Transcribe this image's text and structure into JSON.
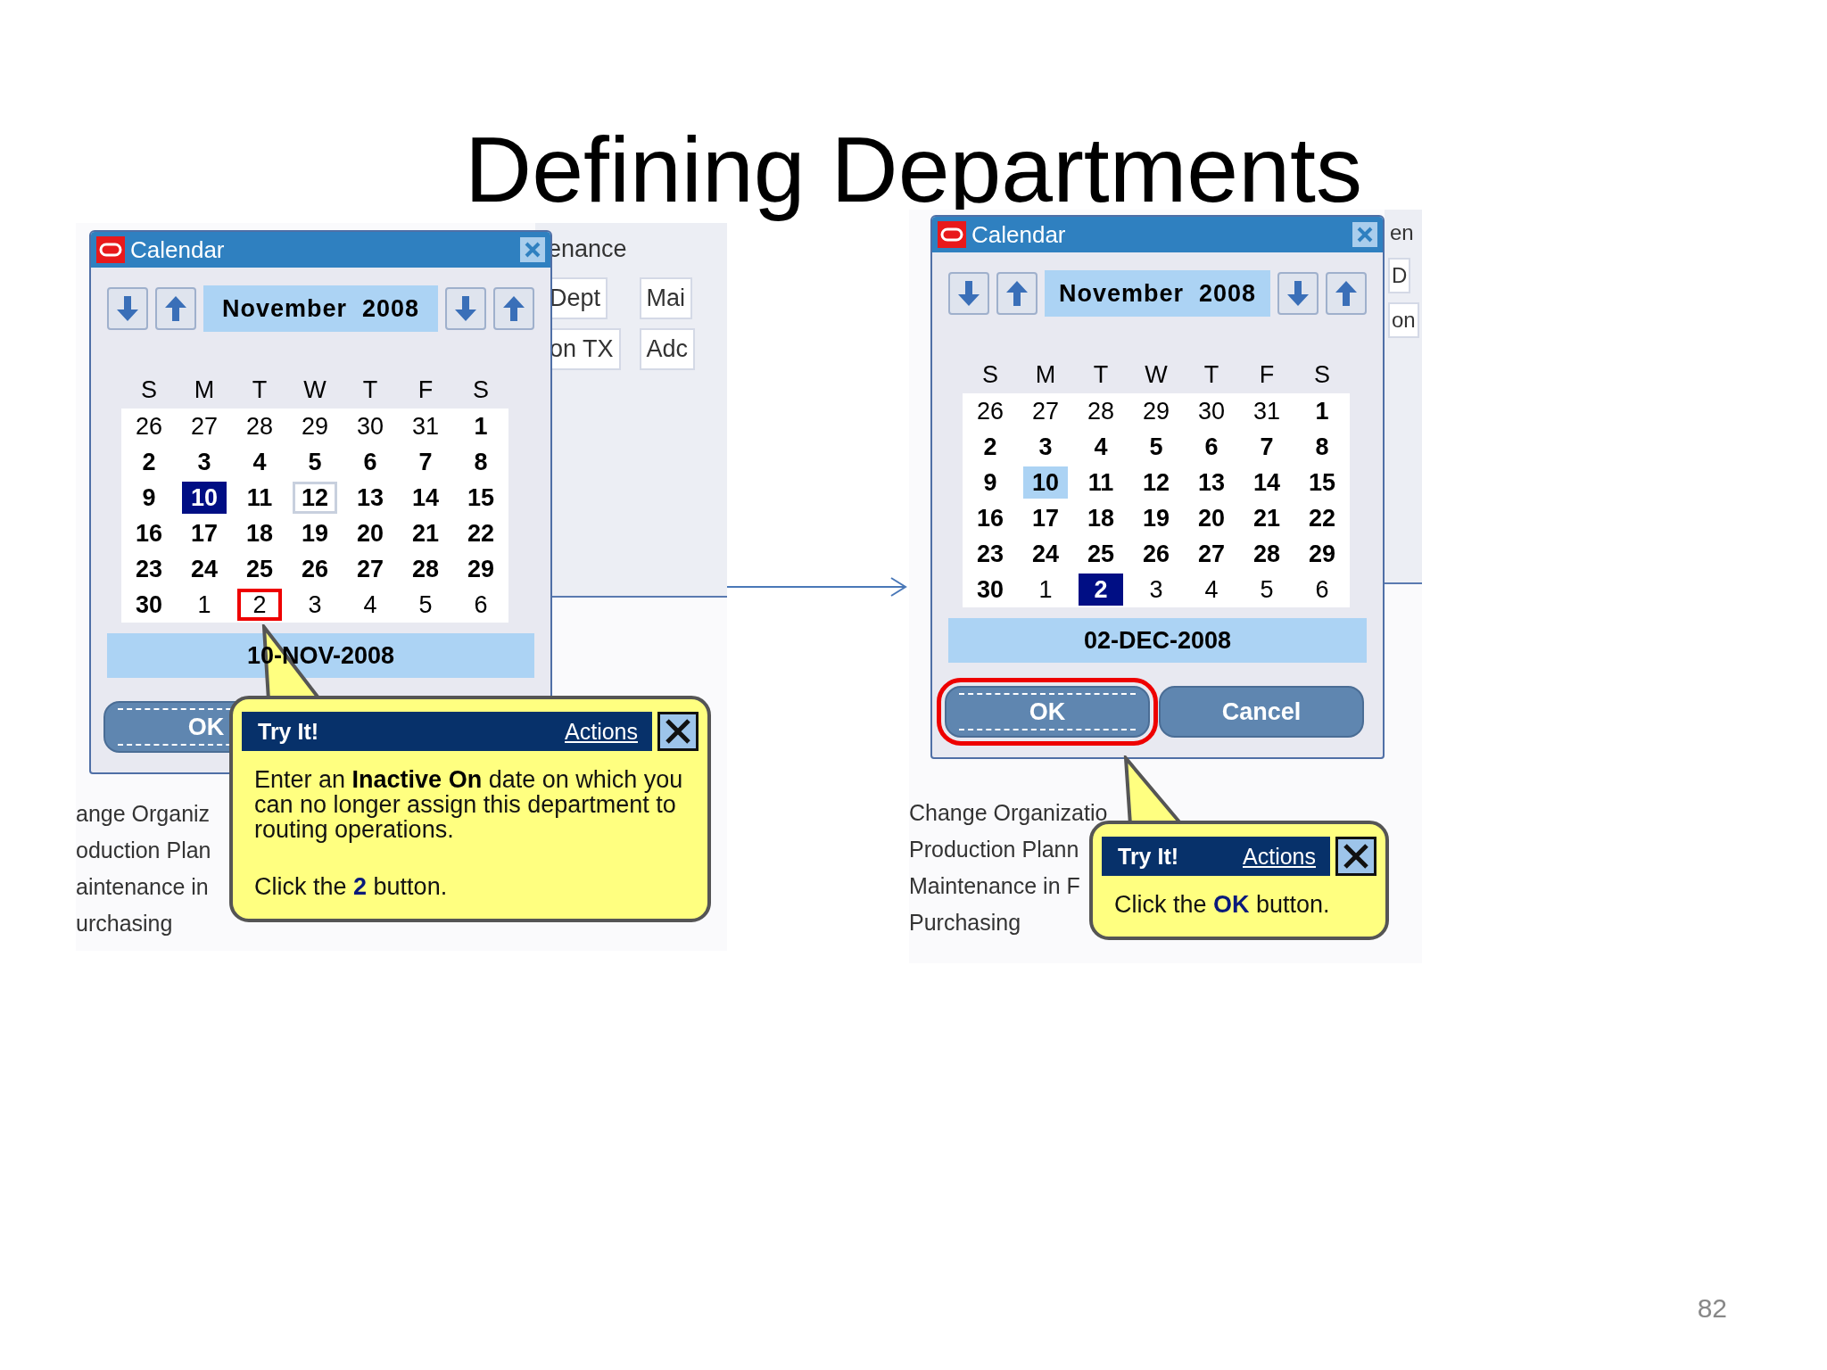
{
  "title": "Defining Departments",
  "panels": [
    {
      "backdrop": {
        "top_texts": [
          "enance",
          "Dept",
          "Mai",
          "on TX",
          "Adc"
        ],
        "list": [
          "ange Organiz",
          "oduction Plan",
          "aintenance in",
          "urchasing"
        ]
      },
      "calendar": {
        "title": "Calendar",
        "month": "November  2008",
        "weekdays": [
          "S",
          "M",
          "T",
          "W",
          "T",
          "F",
          "S"
        ],
        "weeks": [
          [
            {
              "label": "26",
              "outside": true,
              "selected": false,
              "outlined": false,
              "shaded": false,
              "target": false
            },
            {
              "label": "27",
              "outside": true,
              "selected": false,
              "outlined": false,
              "shaded": false,
              "target": false
            },
            {
              "label": "28",
              "outside": true,
              "selected": false,
              "outlined": false,
              "shaded": false,
              "target": false
            },
            {
              "label": "29",
              "outside": true,
              "selected": false,
              "outlined": false,
              "shaded": false,
              "target": false
            },
            {
              "label": "30",
              "outside": true,
              "selected": false,
              "outlined": false,
              "shaded": false,
              "target": false
            },
            {
              "label": "31",
              "outside": true,
              "selected": false,
              "outlined": false,
              "shaded": false,
              "target": false
            },
            {
              "label": "1",
              "outside": false,
              "selected": false,
              "outlined": false,
              "shaded": false,
              "target": false
            }
          ],
          [
            {
              "label": "2",
              "outside": false,
              "selected": false,
              "outlined": false,
              "shaded": false,
              "target": false
            },
            {
              "label": "3",
              "outside": false,
              "selected": false,
              "outlined": false,
              "shaded": false,
              "target": false
            },
            {
              "label": "4",
              "outside": false,
              "selected": false,
              "outlined": false,
              "shaded": false,
              "target": false
            },
            {
              "label": "5",
              "outside": false,
              "selected": false,
              "outlined": false,
              "shaded": false,
              "target": false
            },
            {
              "label": "6",
              "outside": false,
              "selected": false,
              "outlined": false,
              "shaded": false,
              "target": false
            },
            {
              "label": "7",
              "outside": false,
              "selected": false,
              "outlined": false,
              "shaded": false,
              "target": false
            },
            {
              "label": "8",
              "outside": false,
              "selected": false,
              "outlined": false,
              "shaded": false,
              "target": false
            }
          ],
          [
            {
              "label": "9",
              "outside": false,
              "selected": false,
              "outlined": false,
              "shaded": false,
              "target": false
            },
            {
              "label": "10",
              "outside": false,
              "selected": true,
              "outlined": false,
              "shaded": false,
              "target": false
            },
            {
              "label": "11",
              "outside": false,
              "selected": false,
              "outlined": false,
              "shaded": false,
              "target": false
            },
            {
              "label": "12",
              "outside": false,
              "selected": false,
              "outlined": true,
              "shaded": false,
              "target": false
            },
            {
              "label": "13",
              "outside": false,
              "selected": false,
              "outlined": false,
              "shaded": false,
              "target": false
            },
            {
              "label": "14",
              "outside": false,
              "selected": false,
              "outlined": false,
              "shaded": false,
              "target": false
            },
            {
              "label": "15",
              "outside": false,
              "selected": false,
              "outlined": false,
              "shaded": false,
              "target": false
            }
          ],
          [
            {
              "label": "16",
              "outside": false,
              "selected": false,
              "outlined": false,
              "shaded": false,
              "target": false
            },
            {
              "label": "17",
              "outside": false,
              "selected": false,
              "outlined": false,
              "shaded": false,
              "target": false
            },
            {
              "label": "18",
              "outside": false,
              "selected": false,
              "outlined": false,
              "shaded": false,
              "target": false
            },
            {
              "label": "19",
              "outside": false,
              "selected": false,
              "outlined": false,
              "shaded": false,
              "target": false
            },
            {
              "label": "20",
              "outside": false,
              "selected": false,
              "outlined": false,
              "shaded": false,
              "target": false
            },
            {
              "label": "21",
              "outside": false,
              "selected": false,
              "outlined": false,
              "shaded": false,
              "target": false
            },
            {
              "label": "22",
              "outside": false,
              "selected": false,
              "outlined": false,
              "shaded": false,
              "target": false
            }
          ],
          [
            {
              "label": "23",
              "outside": false,
              "selected": false,
              "outlined": false,
              "shaded": false,
              "target": false
            },
            {
              "label": "24",
              "outside": false,
              "selected": false,
              "outlined": false,
              "shaded": false,
              "target": false
            },
            {
              "label": "25",
              "outside": false,
              "selected": false,
              "outlined": false,
              "shaded": false,
              "target": false
            },
            {
              "label": "26",
              "outside": false,
              "selected": false,
              "outlined": false,
              "shaded": false,
              "target": false
            },
            {
              "label": "27",
              "outside": false,
              "selected": false,
              "outlined": false,
              "shaded": false,
              "target": false
            },
            {
              "label": "28",
              "outside": false,
              "selected": false,
              "outlined": false,
              "shaded": false,
              "target": false
            },
            {
              "label": "29",
              "outside": false,
              "selected": false,
              "outlined": false,
              "shaded": false,
              "target": false
            }
          ],
          [
            {
              "label": "30",
              "outside": false,
              "selected": false,
              "outlined": false,
              "shaded": false,
              "target": false
            },
            {
              "label": "1",
              "outside": true,
              "selected": false,
              "outlined": false,
              "shaded": false,
              "target": false
            },
            {
              "label": "2",
              "outside": true,
              "selected": false,
              "outlined": false,
              "shaded": false,
              "target": true
            },
            {
              "label": "3",
              "outside": true,
              "selected": false,
              "outlined": false,
              "shaded": false,
              "target": false
            },
            {
              "label": "4",
              "outside": true,
              "selected": false,
              "outlined": false,
              "shaded": false,
              "target": false
            },
            {
              "label": "5",
              "outside": true,
              "selected": false,
              "outlined": false,
              "shaded": false,
              "target": false
            },
            {
              "label": "6",
              "outside": true,
              "selected": false,
              "outlined": false,
              "shaded": false,
              "target": false
            }
          ]
        ],
        "date": "10-NOV-2008",
        "buttons": [
          {
            "label": "OK",
            "focused": true,
            "target": false
          }
        ]
      },
      "callout": {
        "heading": "Try It!",
        "link": "Actions",
        "paragraphs": [
          "Enter an **Inactive On** date on which you can no longer assign this department to routing operations.",
          "Click the **2** button."
        ]
      }
    },
    {
      "backdrop": {
        "top_texts": [
          "en",
          "D",
          "on"
        ],
        "list": [
          "Change Organizatio",
          "Production Plann",
          "Maintenance in F",
          "Purchasing"
        ]
      },
      "calendar": {
        "title": "Calendar",
        "month": "November  2008",
        "weekdays": [
          "S",
          "M",
          "T",
          "W",
          "T",
          "F",
          "S"
        ],
        "weeks": [
          [
            {
              "label": "26",
              "outside": true,
              "selected": false,
              "outlined": false,
              "shaded": false,
              "target": false
            },
            {
              "label": "27",
              "outside": true,
              "selected": false,
              "outlined": false,
              "shaded": false,
              "target": false
            },
            {
              "label": "28",
              "outside": true,
              "selected": false,
              "outlined": false,
              "shaded": false,
              "target": false
            },
            {
              "label": "29",
              "outside": true,
              "selected": false,
              "outlined": false,
              "shaded": false,
              "target": false
            },
            {
              "label": "30",
              "outside": true,
              "selected": false,
              "outlined": false,
              "shaded": false,
              "target": false
            },
            {
              "label": "31",
              "outside": true,
              "selected": false,
              "outlined": false,
              "shaded": false,
              "target": false
            },
            {
              "label": "1",
              "outside": false,
              "selected": false,
              "outlined": false,
              "shaded": false,
              "target": false
            }
          ],
          [
            {
              "label": "2",
              "outside": false,
              "selected": false,
              "outlined": false,
              "shaded": false,
              "target": false
            },
            {
              "label": "3",
              "outside": false,
              "selected": false,
              "outlined": false,
              "shaded": false,
              "target": false
            },
            {
              "label": "4",
              "outside": false,
              "selected": false,
              "outlined": false,
              "shaded": false,
              "target": false
            },
            {
              "label": "5",
              "outside": false,
              "selected": false,
              "outlined": false,
              "shaded": false,
              "target": false
            },
            {
              "label": "6",
              "outside": false,
              "selected": false,
              "outlined": false,
              "shaded": false,
              "target": false
            },
            {
              "label": "7",
              "outside": false,
              "selected": false,
              "outlined": false,
              "shaded": false,
              "target": false
            },
            {
              "label": "8",
              "outside": false,
              "selected": false,
              "outlined": false,
              "shaded": false,
              "target": false
            }
          ],
          [
            {
              "label": "9",
              "outside": false,
              "selected": false,
              "outlined": false,
              "shaded": false,
              "target": false
            },
            {
              "label": "10",
              "outside": false,
              "selected": false,
              "outlined": false,
              "shaded": true,
              "target": false
            },
            {
              "label": "11",
              "outside": false,
              "selected": false,
              "outlined": false,
              "shaded": false,
              "target": false
            },
            {
              "label": "12",
              "outside": false,
              "selected": false,
              "outlined": false,
              "shaded": false,
              "target": false
            },
            {
              "label": "13",
              "outside": false,
              "selected": false,
              "outlined": false,
              "shaded": false,
              "target": false
            },
            {
              "label": "14",
              "outside": false,
              "selected": false,
              "outlined": false,
              "shaded": false,
              "target": false
            },
            {
              "label": "15",
              "outside": false,
              "selected": false,
              "outlined": false,
              "shaded": false,
              "target": false
            }
          ],
          [
            {
              "label": "16",
              "outside": false,
              "selected": false,
              "outlined": false,
              "shaded": false,
              "target": false
            },
            {
              "label": "17",
              "outside": false,
              "selected": false,
              "outlined": false,
              "shaded": false,
              "target": false
            },
            {
              "label": "18",
              "outside": false,
              "selected": false,
              "outlined": false,
              "shaded": false,
              "target": false
            },
            {
              "label": "19",
              "outside": false,
              "selected": false,
              "outlined": false,
              "shaded": false,
              "target": false
            },
            {
              "label": "20",
              "outside": false,
              "selected": false,
              "outlined": false,
              "shaded": false,
              "target": false
            },
            {
              "label": "21",
              "outside": false,
              "selected": false,
              "outlined": false,
              "shaded": false,
              "target": false
            },
            {
              "label": "22",
              "outside": false,
              "selected": false,
              "outlined": false,
              "shaded": false,
              "target": false
            }
          ],
          [
            {
              "label": "23",
              "outside": false,
              "selected": false,
              "outlined": false,
              "shaded": false,
              "target": false
            },
            {
              "label": "24",
              "outside": false,
              "selected": false,
              "outlined": false,
              "shaded": false,
              "target": false
            },
            {
              "label": "25",
              "outside": false,
              "selected": false,
              "outlined": false,
              "shaded": false,
              "target": false
            },
            {
              "label": "26",
              "outside": false,
              "selected": false,
              "outlined": false,
              "shaded": false,
              "target": false
            },
            {
              "label": "27",
              "outside": false,
              "selected": false,
              "outlined": false,
              "shaded": false,
              "target": false
            },
            {
              "label": "28",
              "outside": false,
              "selected": false,
              "outlined": false,
              "shaded": false,
              "target": false
            },
            {
              "label": "29",
              "outside": false,
              "selected": false,
              "outlined": false,
              "shaded": false,
              "target": false
            }
          ],
          [
            {
              "label": "30",
              "outside": false,
              "selected": false,
              "outlined": false,
              "shaded": false,
              "target": false
            },
            {
              "label": "1",
              "outside": true,
              "selected": false,
              "outlined": false,
              "shaded": false,
              "target": false
            },
            {
              "label": "2",
              "outside": false,
              "selected": true,
              "outlined": false,
              "shaded": false,
              "target": false
            },
            {
              "label": "3",
              "outside": true,
              "selected": false,
              "outlined": false,
              "shaded": false,
              "target": false
            },
            {
              "label": "4",
              "outside": true,
              "selected": false,
              "outlined": false,
              "shaded": false,
              "target": false
            },
            {
              "label": "5",
              "outside": true,
              "selected": false,
              "outlined": false,
              "shaded": false,
              "target": false
            },
            {
              "label": "6",
              "outside": true,
              "selected": false,
              "outlined": false,
              "shaded": false,
              "target": false
            }
          ]
        ],
        "date": "02-DEC-2008",
        "buttons": [
          {
            "label": "OK",
            "focused": true,
            "target": true
          },
          {
            "label": "Cancel",
            "focused": false,
            "target": false
          }
        ]
      },
      "callout": {
        "heading": "Try It!",
        "link": "Actions",
        "paragraphs": [
          "Click the **OK** button."
        ]
      }
    }
  ],
  "page_number": "82"
}
